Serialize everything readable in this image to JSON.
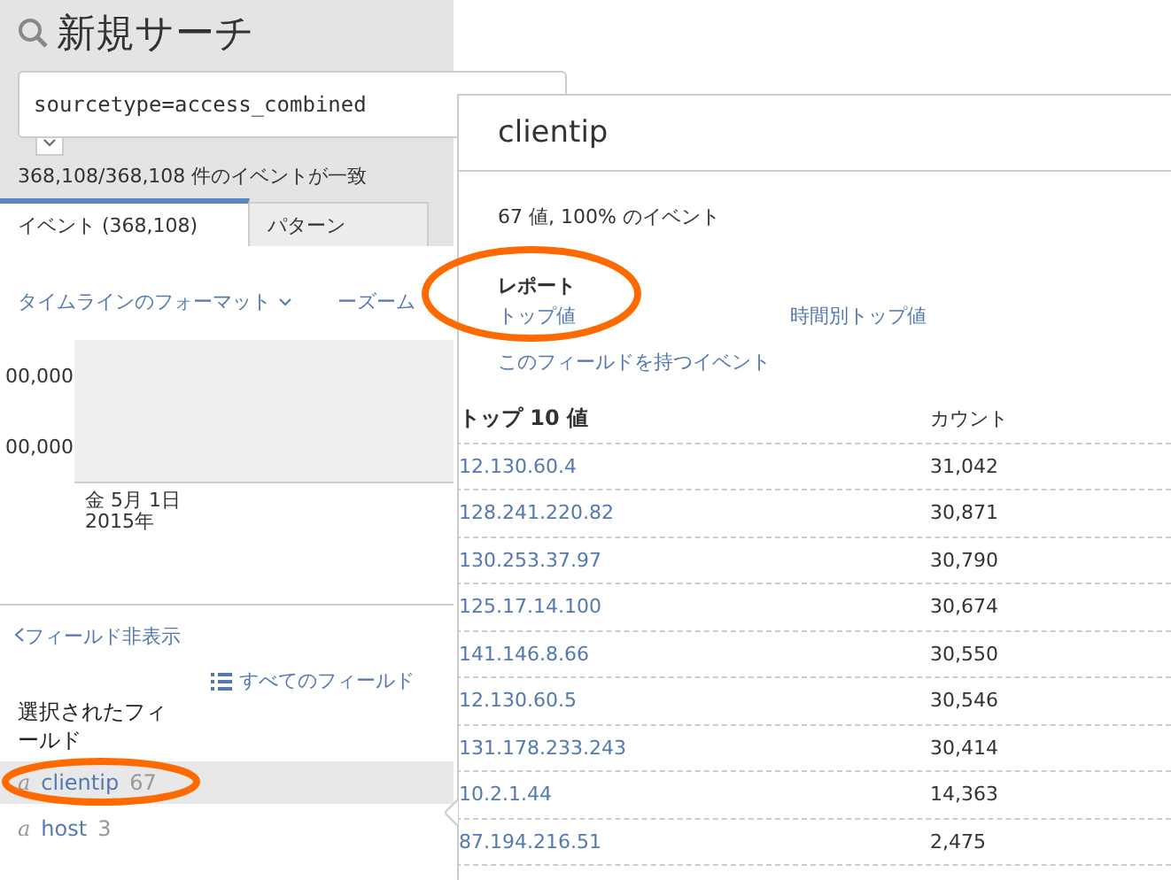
{
  "title": "新規サーチ",
  "search": {
    "value": "sourcetype=access_combined"
  },
  "match_count": "368,108/368,108 件のイベントが一致",
  "tabs": [
    {
      "label": "イベント (368,108)",
      "selected": true
    },
    {
      "label": "パターン",
      "selected": false
    }
  ],
  "timeline": {
    "format_link": "タイムラインのフォーマット",
    "zoom_link": "ーズーム",
    "y_labels": [
      "00,000",
      "00,000"
    ],
    "date": "金 5月 1日",
    "year": "2015年"
  },
  "fields_panel": {
    "hide_link": "フィールド非表示",
    "all_fields": "すべてのフィールド",
    "selected_heading": "選択されたフィールド",
    "fields": [
      {
        "type": "a",
        "name": "clientip",
        "count": "67",
        "selected": true
      },
      {
        "type": "a",
        "name": "host",
        "count": "3",
        "selected": false
      }
    ]
  },
  "popup": {
    "title": "clientip",
    "summary": "67 値, 100% のイベント",
    "reports_heading": "レポート",
    "report_links": [
      "トップ値",
      "時間別トップ値",
      "このフィールドを持つイベント"
    ],
    "table": {
      "columns": [
        "トップ 10 値",
        "カウント"
      ],
      "rows": [
        [
          "12.130.60.4",
          "31,042"
        ],
        [
          "128.241.220.82",
          "30,871"
        ],
        [
          "130.253.37.97",
          "30,790"
        ],
        [
          "125.17.14.100",
          "30,674"
        ],
        [
          "141.146.8.66",
          "30,550"
        ],
        [
          "12.130.60.5",
          "30,546"
        ],
        [
          "131.178.233.243",
          "30,414"
        ],
        [
          "10.2.1.44",
          "14,363"
        ],
        [
          "87.194.216.51",
          "2,475"
        ]
      ]
    }
  }
}
